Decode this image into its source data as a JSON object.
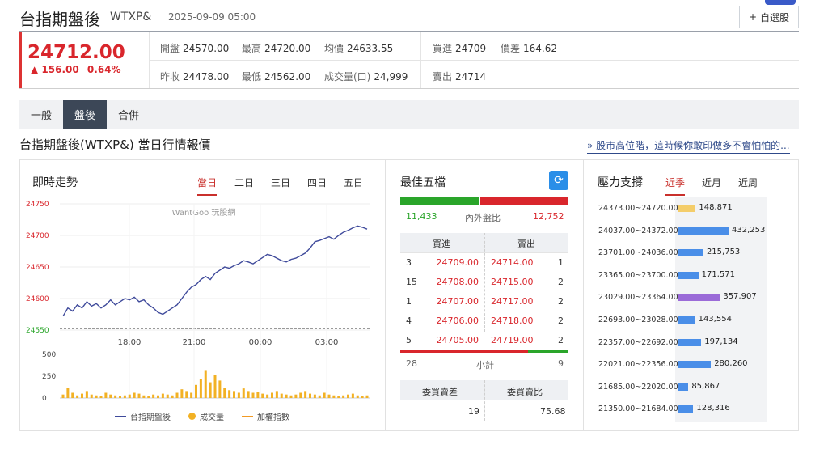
{
  "header": {
    "title": "台指期盤後",
    "code": "WTXP&",
    "datetime": "2025-09-09 05:00",
    "fav_button": "自選股",
    "fav_icon": "plus-icon"
  },
  "quote": {
    "price": "24712.00",
    "change": "156.00",
    "change_pct": "0.64%",
    "open_label": "開盤",
    "open": "24570.00",
    "high_label": "最高",
    "high": "24720.00",
    "avg_label": "均價",
    "avg": "24633.55",
    "bid_label": "買進",
    "bid": "24709",
    "spread_label": "價差",
    "spread": "164.62",
    "prev_label": "昨收",
    "prev": "24478.00",
    "low_label": "最低",
    "low": "24562.00",
    "volume_label": "成交量(口)",
    "volume": "24,999",
    "ask_label": "賣出",
    "ask": "24714",
    "up_color": "#d9262c"
  },
  "tabs": [
    {
      "label": "一般",
      "active": false
    },
    {
      "label": "盤後",
      "active": true
    },
    {
      "label": "合併",
      "active": false
    }
  ],
  "section": {
    "title": "台指期盤後(WTXP&) 當日行情報價",
    "link": "» 股市高位階，這時候你敢印做多不會怕怕的..."
  },
  "intraday": {
    "title": "即時走勢",
    "tabs": [
      "當日",
      "二日",
      "三日",
      "四日",
      "五日"
    ],
    "watermark": "WantGoo 玩股網",
    "legend": [
      {
        "label": "台指期盤後",
        "color": "#3f4a9b",
        "icon": "line-icon"
      },
      {
        "label": "成交量",
        "color": "#f2b124",
        "icon": "dot-icon"
      },
      {
        "label": "加權指數",
        "color": "#f29a24",
        "icon": "line-icon"
      }
    ]
  },
  "chart_data": {
    "type": "line",
    "title": "",
    "x_ticks": [
      "18:00",
      "21:00",
      "00:00",
      "03:00"
    ],
    "y_ticks": [
      "24750",
      "24700",
      "24650",
      "24600",
      "24550"
    ],
    "ylim": [
      24550,
      24750
    ],
    "prev_close": 24478,
    "series": [
      {
        "name": "台指期盤後",
        "color": "#3f4a9b",
        "values": [
          24572,
          24585,
          24580,
          24590,
          24585,
          24595,
          24588,
          24592,
          24585,
          24590,
          24598,
          24590,
          24595,
          24600,
          24598,
          24602,
          24595,
          24598,
          24590,
          24585,
          24578,
          24575,
          24580,
          24585,
          24590,
          24600,
          24610,
          24618,
          24622,
          24630,
          24635,
          24630,
          24640,
          24645,
          24650,
          24648,
          24652,
          24655,
          24660,
          24658,
          24655,
          24660,
          24665,
          24670,
          24668,
          24664,
          24660,
          24658,
          24662,
          24664,
          24668,
          24672,
          24680,
          24690,
          24692,
          24695,
          24698,
          24694,
          24700,
          24705,
          24708,
          24712,
          24715,
          24713,
          24710
        ]
      }
    ],
    "volume": {
      "ylim": [
        0,
        500
      ],
      "y_ticks": [
        "500",
        "250",
        "0"
      ],
      "color": "#f2b124",
      "values": [
        40,
        120,
        60,
        30,
        50,
        80,
        40,
        30,
        20,
        60,
        40,
        30,
        20,
        30,
        40,
        60,
        50,
        30,
        20,
        40,
        30,
        50,
        40,
        30,
        60,
        100,
        80,
        60,
        150,
        220,
        320,
        180,
        260,
        200,
        120,
        90,
        80,
        60,
        110,
        80,
        60,
        70,
        50,
        40,
        60,
        80,
        50,
        40,
        30,
        40,
        60,
        80,
        50,
        40,
        30,
        60,
        40,
        30,
        20,
        30,
        40,
        50,
        30,
        20,
        30
      ]
    }
  },
  "best5": {
    "title": "最佳五檔",
    "refresh_icon": "refresh-icon",
    "inner_outer_label": "內外盤比",
    "inner_qty": "11,433",
    "outer_qty": "12,752",
    "inner_ratio": 0.473,
    "buy_header": "買進",
    "sell_header": "賣出",
    "rows": [
      {
        "bq": "3",
        "bp": "24709.00",
        "sp": "24714.00",
        "sq": "1"
      },
      {
        "bq": "15",
        "bp": "24708.00",
        "sp": "24715.00",
        "sq": "2"
      },
      {
        "bq": "1",
        "bp": "24707.00",
        "sp": "24717.00",
        "sq": "2"
      },
      {
        "bq": "4",
        "bp": "24706.00",
        "sp": "24718.00",
        "sq": "2"
      },
      {
        "bq": "5",
        "bp": "24705.00",
        "sp": "24719.00",
        "sq": "2"
      }
    ],
    "sub_label": "小計",
    "buy_total": "28",
    "sell_total": "9",
    "buy_total_ratio": 0.76,
    "diff_label": "委買賣差",
    "ratio_label": "委買賣比",
    "diff": "19",
    "ratio": "75.68",
    "green": "#2aa52a",
    "red": "#d9262c"
  },
  "pressure": {
    "title": "壓力支撐",
    "tabs": [
      "近季",
      "近月",
      "近周"
    ],
    "max": 432253,
    "rows": [
      {
        "range": "24373.00~24720.00",
        "value": 148871,
        "label": "148,871",
        "color": "#f4cd6a"
      },
      {
        "range": "24037.00~24372.00",
        "value": 432253,
        "label": "432,253",
        "color": "#4a8ee8"
      },
      {
        "range": "23701.00~24036.00",
        "value": 215753,
        "label": "215,753",
        "color": "#4a8ee8"
      },
      {
        "range": "23365.00~23700.00",
        "value": 171571,
        "label": "171,571",
        "color": "#4a8ee8"
      },
      {
        "range": "23029.00~23364.00",
        "value": 357907,
        "label": "357,907",
        "color": "#9b6bd8"
      },
      {
        "range": "22693.00~23028.00",
        "value": 143554,
        "label": "143,554",
        "color": "#4a8ee8"
      },
      {
        "range": "22357.00~22692.00",
        "value": 197134,
        "label": "197,134",
        "color": "#4a8ee8"
      },
      {
        "range": "22021.00~22356.00",
        "value": 280260,
        "label": "280,260",
        "color": "#4a8ee8"
      },
      {
        "range": "21685.00~22020.00",
        "value": 85867,
        "label": "85,867",
        "color": "#4a8ee8"
      },
      {
        "range": "21350.00~21684.00",
        "value": 128316,
        "label": "128,316",
        "color": "#4a8ee8"
      }
    ]
  }
}
